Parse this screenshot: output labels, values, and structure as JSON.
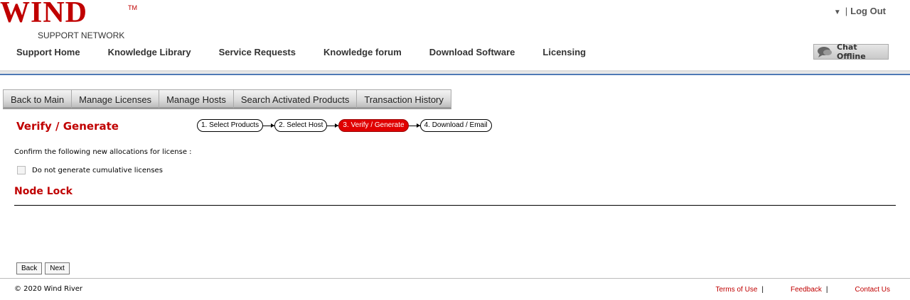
{
  "header": {
    "logo_text": "WIND",
    "logo_tm": "TM",
    "logo_sub": "SUPPORT NETWORK",
    "logout_label": "Log Out",
    "separator": "|",
    "chat_label": "Chat Offline"
  },
  "nav": {
    "items": [
      {
        "label": "Support Home"
      },
      {
        "label": "Knowledge Library"
      },
      {
        "label": "Service Requests"
      },
      {
        "label": "Knowledge forum"
      },
      {
        "label": "Download Software"
      },
      {
        "label": "Licensing"
      }
    ]
  },
  "tabs": [
    {
      "label": "Back to Main"
    },
    {
      "label": "Manage Licenses"
    },
    {
      "label": "Manage Hosts"
    },
    {
      "label": "Search Activated Products"
    },
    {
      "label": "Transaction History"
    }
  ],
  "page": {
    "title": "Verify / Generate",
    "steps": [
      {
        "label": "1. Select Products"
      },
      {
        "label": "2. Select Host"
      },
      {
        "label": "3. Verify / Generate"
      },
      {
        "label": "4. Download / Email"
      }
    ],
    "confirm_text": "Confirm the following new allocations for license :",
    "checkbox_label": "Do not generate cumulative licenses",
    "section_title": "Node Lock",
    "back_label": "Back",
    "next_label": "Next"
  },
  "footer": {
    "copyright": "© 2020 Wind River",
    "terms": "Terms of Use",
    "feedback": "Feedback",
    "contact": "Contact Us",
    "separator": "|"
  },
  "colors": {
    "brand": "#c00000",
    "accent_blue": "#4f79b5",
    "active_step": "#e00000"
  }
}
